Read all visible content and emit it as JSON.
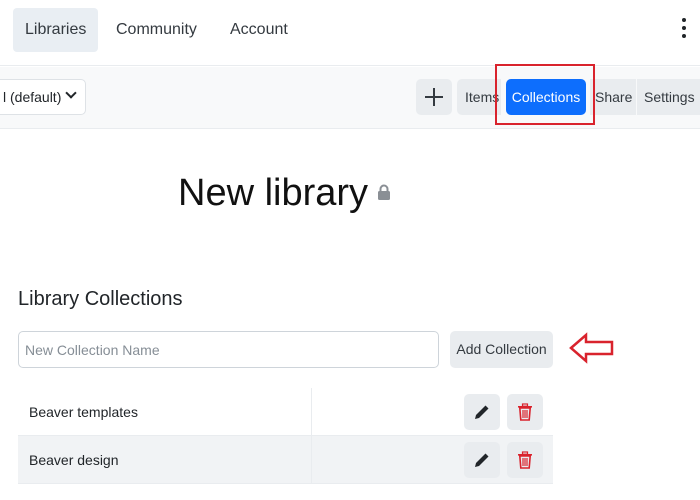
{
  "nav": {
    "tabs": [
      {
        "label": "Libraries"
      },
      {
        "label": "Community"
      },
      {
        "label": "Account"
      }
    ]
  },
  "toolbar": {
    "library_select": "l (default)",
    "buttons": {
      "items": "Items",
      "collections": "Collections",
      "share": "Share",
      "settings": "Settings"
    }
  },
  "page": {
    "title": "New library"
  },
  "collections": {
    "heading": "Library Collections",
    "input_placeholder": "New Collection Name",
    "input_value": "",
    "add_label": "Add Collection",
    "list": [
      {
        "name": "Beaver templates"
      },
      {
        "name": "Beaver design"
      }
    ]
  },
  "colors": {
    "primary": "#0d6efd",
    "highlight": "#d9232d",
    "delete": "#d9232d"
  },
  "icons": [
    "plus-icon",
    "chevron-down-icon",
    "lock-icon",
    "pencil-icon",
    "trash-icon",
    "kebab-menu-icon",
    "left-arrow-annotation"
  ]
}
